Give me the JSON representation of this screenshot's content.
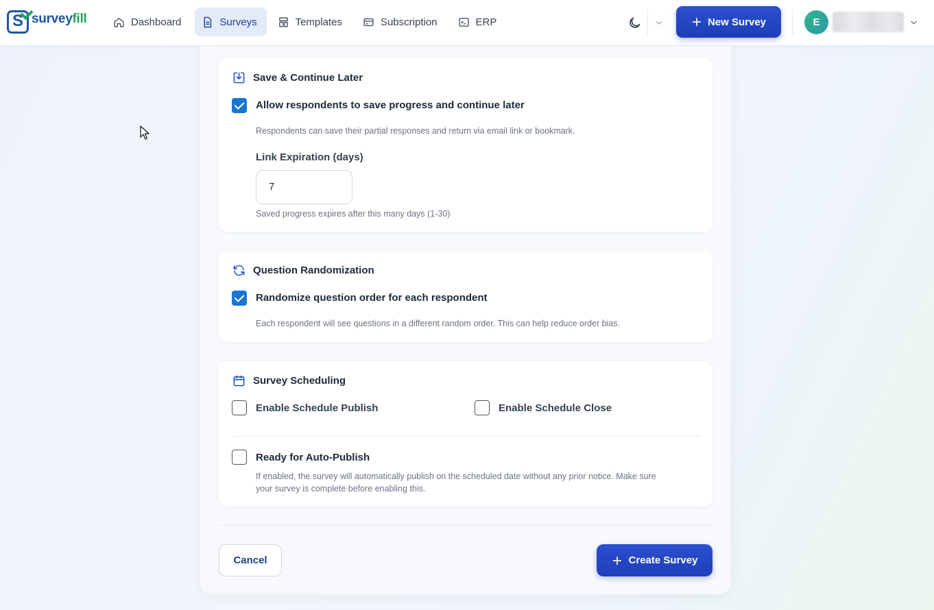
{
  "brand": {
    "name_part1": "survey",
    "name_part2": "fill"
  },
  "nav": {
    "items": [
      {
        "label": "Dashboard",
        "icon": "home-icon",
        "active": false
      },
      {
        "label": "Surveys",
        "icon": "document-icon",
        "active": true
      },
      {
        "label": "Templates",
        "icon": "template-icon",
        "active": false
      },
      {
        "label": "Subscription",
        "icon": "card-icon",
        "active": false
      },
      {
        "label": "ERP",
        "icon": "terminal-icon",
        "active": false
      }
    ],
    "new_survey_label": "New Survey",
    "user_initial": "E"
  },
  "save_continue": {
    "title": "Save & Continue Later",
    "checkbox_label": "Allow respondents to save progress and continue later",
    "checked": true,
    "help": "Respondents can save their partial responses and return via email link or bookmark.",
    "expiration_label": "Link Expiration (days)",
    "expiration_value": "7",
    "expiration_help": "Saved progress expires after this many days (1-30)"
  },
  "randomization": {
    "title": "Question Randomization",
    "checkbox_label": "Randomize question order for each respondent",
    "checked": true,
    "help": "Each respondent will see questions in a different random order. This can help reduce order bias."
  },
  "scheduling": {
    "title": "Survey Scheduling",
    "schedule_publish_label": "Enable Schedule Publish",
    "schedule_close_label": "Enable Schedule Close",
    "auto_publish_label": "Ready for Auto-Publish",
    "auto_publish_help_line1": "If enabled, the survey will automatically publish on the scheduled date without any prior notice. Make sure",
    "auto_publish_help_line2": "your survey is complete before enabling this."
  },
  "actions": {
    "cancel_label": "Cancel",
    "create_label": "Create Survey"
  },
  "colors": {
    "primary": "#1d3fb8",
    "checkbox": "#1976d2",
    "brand_blue": "#1e56a0",
    "brand_green": "#22a565"
  }
}
